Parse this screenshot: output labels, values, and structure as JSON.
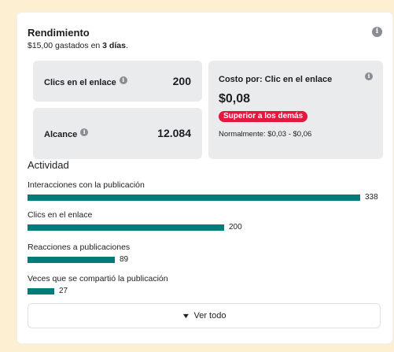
{
  "performance": {
    "title": "Rendimiento",
    "subtitle_prefix": "$15,00 gastados en ",
    "subtitle_bold": "3 días",
    "subtitle_suffix": "."
  },
  "metrics": {
    "link_clicks": {
      "label": "Clics en el enlace",
      "value": "200"
    },
    "reach": {
      "label": "Alcance",
      "value": "12.084"
    },
    "cost": {
      "label": "Costo por: Clic en el enlace",
      "value": "$0,08",
      "badge": "Superior a los demás",
      "normal": "Normalmente: $0,03 - $0,06"
    }
  },
  "activity": {
    "title": "Actividad",
    "max": 338,
    "rows": [
      {
        "label": "Interacciones con la publicación",
        "value": 338
      },
      {
        "label": "Clics en el enlace",
        "value": 200
      },
      {
        "label": "Reacciones a publicaciones",
        "value": 89
      },
      {
        "label": "Veces que se compartió la publicación",
        "value": 27
      }
    ]
  },
  "see_all": {
    "label": "Ver todo"
  },
  "colors": {
    "bar": "#007c7b",
    "badge": "#e4173f",
    "background": "#fdf0d2"
  },
  "icons": {
    "info": "info-icon",
    "chevron": "chevron-down-icon"
  }
}
